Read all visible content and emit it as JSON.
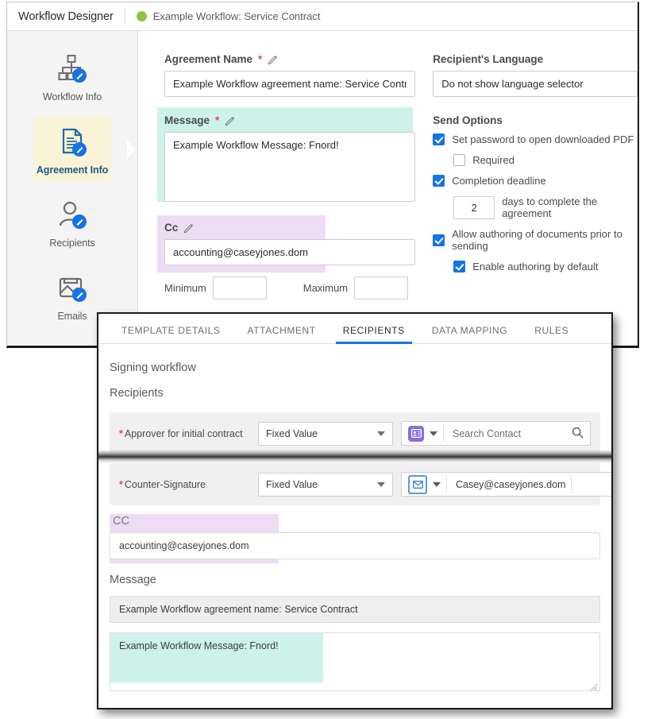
{
  "designer": {
    "title": "Workflow Designer",
    "workflow_name": "Example Workflow: Service Contract",
    "status_color": "#8cc63e",
    "rail": [
      {
        "label": "Workflow Info",
        "icon": "workflow-tree-edit-icon",
        "active": false
      },
      {
        "label": "Agreement Info",
        "icon": "document-edit-icon",
        "active": true
      },
      {
        "label": "Recipients",
        "icon": "person-edit-icon",
        "active": false
      },
      {
        "label": "Emails",
        "icon": "image-mail-edit-icon",
        "active": false
      }
    ],
    "form": {
      "agreement_name": {
        "label": "Agreement Name",
        "required_mark": "*",
        "value": "Example Workflow agreement name: Service Contract"
      },
      "message": {
        "label": "Message",
        "required_mark": "*",
        "value": "Example Workflow Message: Fnord!",
        "highlight_color": "#ccf2ea"
      },
      "cc": {
        "label": "Cc",
        "value": "accounting@caseyjones.dom",
        "highlight_color": "#eedcf5"
      },
      "minimum": {
        "label": "Minimum",
        "value": ""
      },
      "maximum": {
        "label": "Maximum",
        "value": ""
      },
      "recipients_language": {
        "label": "Recipient's Language",
        "value": "Do not show language selector"
      },
      "send_options": {
        "title": "Send Options",
        "items": [
          {
            "label": "Set password to open downloaded PDF",
            "checked": true,
            "indent": false
          },
          {
            "label": "Required",
            "checked": false,
            "indent": true
          },
          {
            "label": "Completion deadline",
            "checked": true,
            "indent": false
          },
          {
            "label": "Allow authoring of documents prior to sending",
            "checked": true,
            "indent": false
          },
          {
            "label": "Enable authoring by default",
            "checked": true,
            "indent": true
          }
        ],
        "deadline_days": "2",
        "deadline_suffix": "days to complete the agreement"
      }
    }
  },
  "template_panel": {
    "tabs": [
      {
        "label": "TEMPLATE DETAILS",
        "active": false
      },
      {
        "label": "ATTACHMENT",
        "active": false
      },
      {
        "label": "RECIPIENTS",
        "active": true
      },
      {
        "label": "DATA MAPPING",
        "active": false
      },
      {
        "label": "RULES",
        "active": false
      }
    ],
    "active_tab_color": "#1473e6",
    "signing_workflow_heading": "Signing workflow",
    "recipients_heading": "Recipients",
    "recipient_rows": [
      {
        "label": "Approver for initial contract",
        "required_mark": "*",
        "source": "Fixed Value",
        "badge": "contact-card-icon",
        "badge_color": "#8a6ee0",
        "contact": "Search Contact",
        "contact_filled": false,
        "has_search_icon": true
      },
      {
        "label": "Counter-Signature",
        "required_mark": "*",
        "source": "Fixed Value",
        "badge": "envelope-icon",
        "badge_color": "#5b9bd5",
        "contact": "Casey@caseyjones.dom",
        "contact_filled": true,
        "has_search_icon": false
      }
    ],
    "cc": {
      "label": "CC",
      "value": "accounting@caseyjones.dom",
      "highlight_color": "#eedcf5"
    },
    "message": {
      "label": "Message",
      "subject_value": "Example Workflow agreement name: Service Contract",
      "body_value": "Example Workflow Message: Fnord!",
      "highlight_color": "#ccf2ea"
    }
  }
}
